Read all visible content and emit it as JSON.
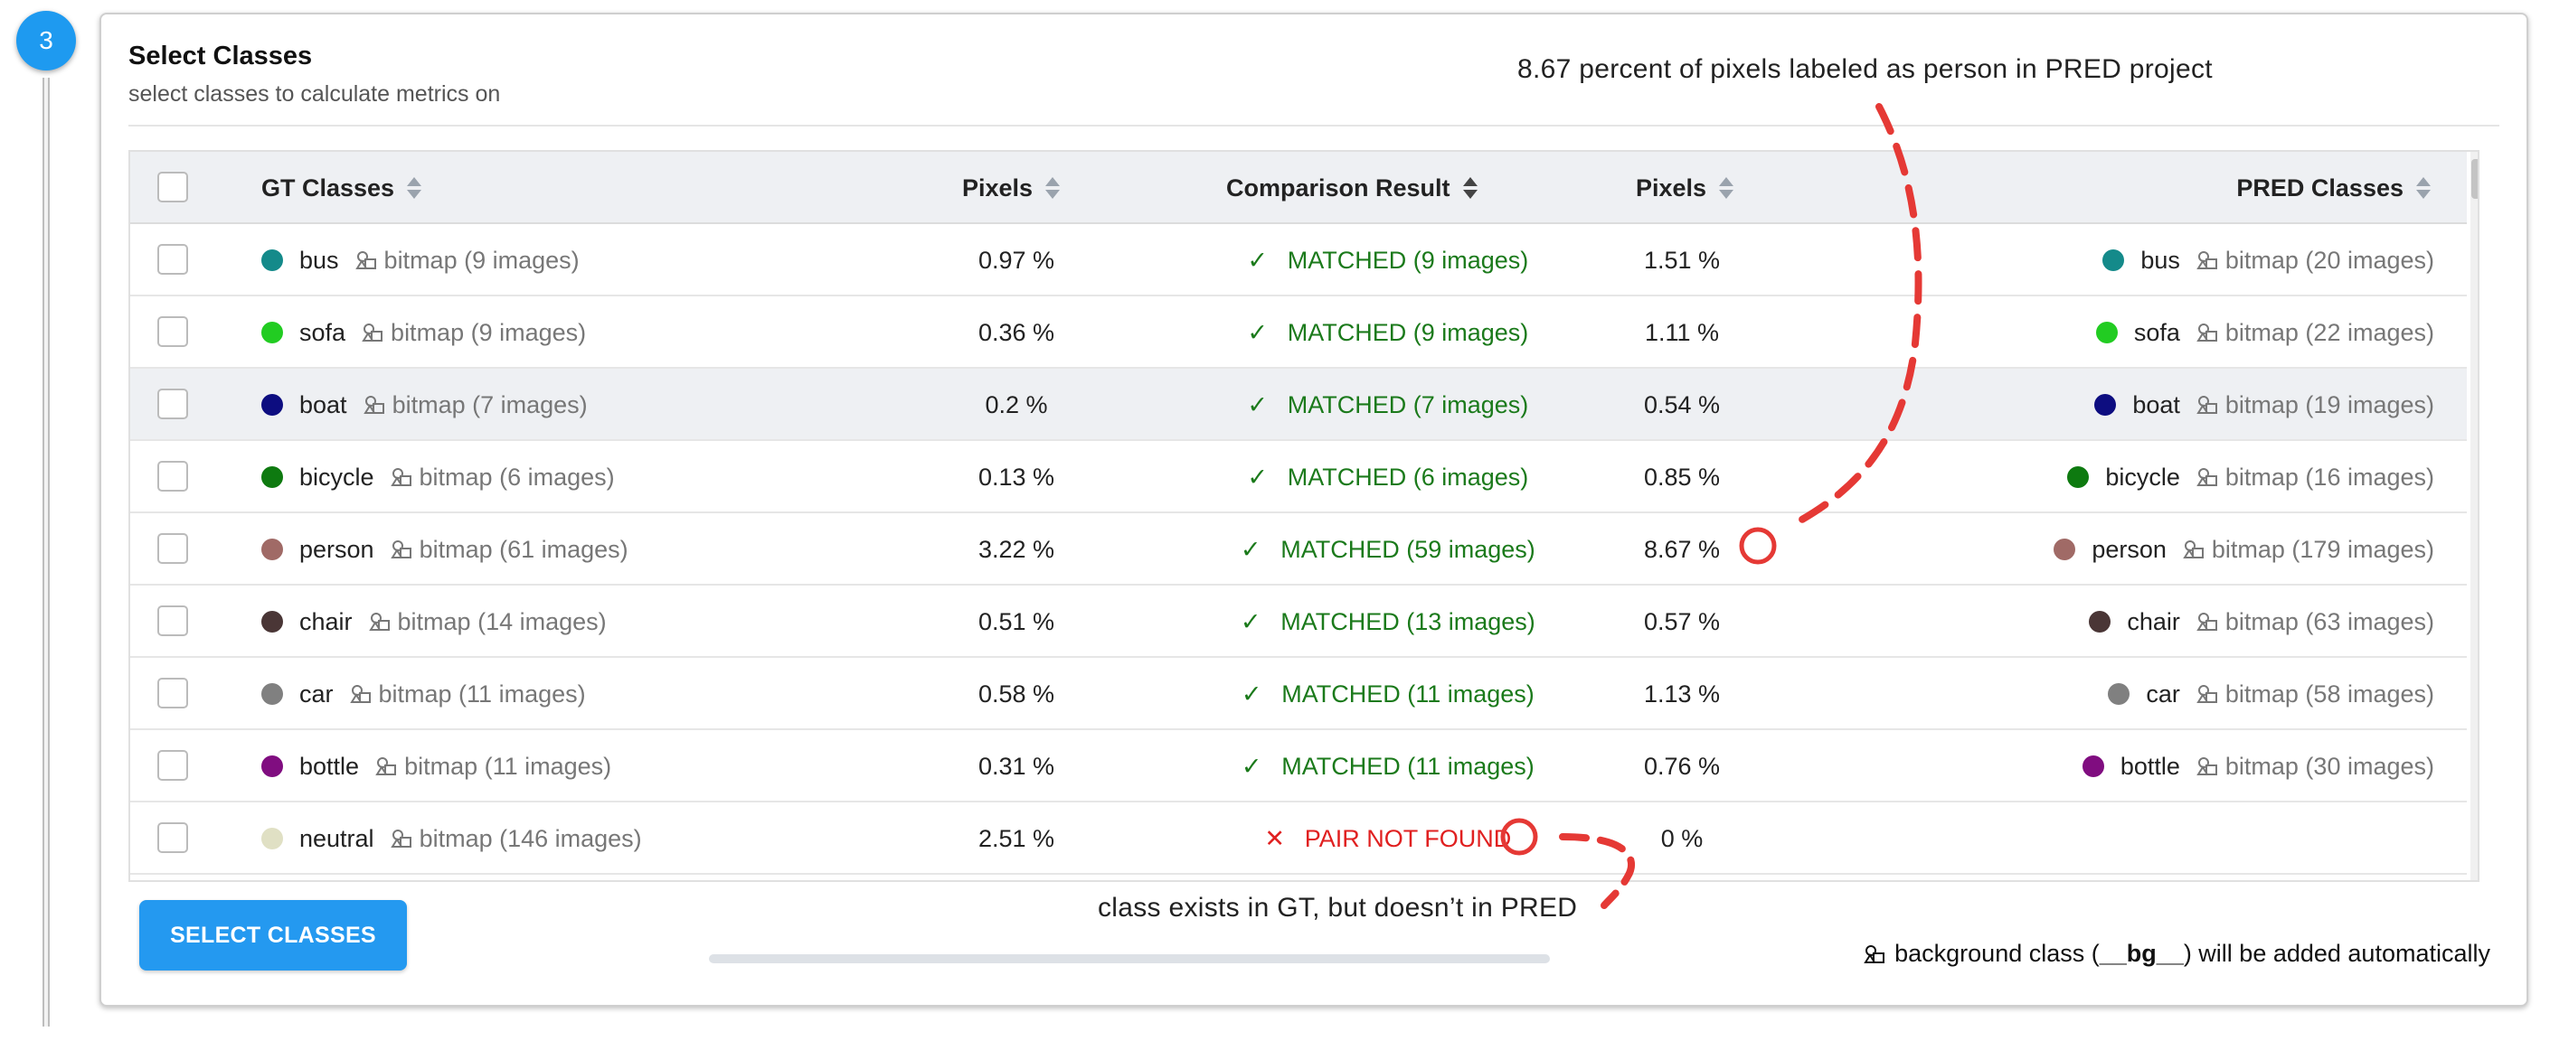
{
  "step": {
    "number": "3"
  },
  "card": {
    "title": "Select Classes",
    "subtitle": "select classes to calculate metrics on"
  },
  "table": {
    "headers": {
      "gt_classes": "GT Classes",
      "gt_pixels": "Pixels",
      "comparison": "Comparison Result",
      "pred_pixels": "Pixels",
      "pred_classes": "PRED Classes"
    },
    "rows": [
      {
        "gt_name": "bus",
        "gt_color": "#148a8a",
        "gt_bitmap": "bitmap (9 images)",
        "gt_pixels": "0.97 %",
        "status": "matched",
        "result": "MATCHED (9 images)",
        "pred_pixels": "1.51 %",
        "pred_name": "bus",
        "pred_color": "#148a8a",
        "pred_bitmap": "bitmap (20 images)"
      },
      {
        "gt_name": "sofa",
        "gt_color": "#22cc22",
        "gt_bitmap": "bitmap (9 images)",
        "gt_pixels": "0.36 %",
        "status": "matched",
        "result": "MATCHED (9 images)",
        "pred_pixels": "1.11 %",
        "pred_name": "sofa",
        "pred_color": "#22cc22",
        "pred_bitmap": "bitmap (22 images)"
      },
      {
        "gt_name": "boat",
        "gt_color": "#0d0d80",
        "gt_bitmap": "bitmap (7 images)",
        "gt_pixels": "0.2 %",
        "status": "matched",
        "result": "MATCHED (7 images)",
        "pred_pixels": "0.54 %",
        "pred_name": "boat",
        "pred_color": "#0d0d80",
        "pred_bitmap": "bitmap (19 images)"
      },
      {
        "gt_name": "bicycle",
        "gt_color": "#0e7a10",
        "gt_bitmap": "bitmap (6 images)",
        "gt_pixels": "0.13 %",
        "status": "matched",
        "result": "MATCHED (6 images)",
        "pred_pixels": "0.85 %",
        "pred_name": "bicycle",
        "pred_color": "#0e7a10",
        "pred_bitmap": "bitmap (16 images)"
      },
      {
        "gt_name": "person",
        "gt_color": "#a06a66",
        "gt_bitmap": "bitmap (61 images)",
        "gt_pixels": "3.22 %",
        "status": "matched",
        "result": "MATCHED (59 images)",
        "pred_pixels": "8.67 %",
        "pred_name": "person",
        "pred_color": "#a06a66",
        "pred_bitmap": "bitmap (179 images)"
      },
      {
        "gt_name": "chair",
        "gt_color": "#4a3636",
        "gt_bitmap": "bitmap (14 images)",
        "gt_pixels": "0.51 %",
        "status": "matched",
        "result": "MATCHED (13 images)",
        "pred_pixels": "0.57 %",
        "pred_name": "chair",
        "pred_color": "#4a3636",
        "pred_bitmap": "bitmap (63 images)"
      },
      {
        "gt_name": "car",
        "gt_color": "#808080",
        "gt_bitmap": "bitmap (11 images)",
        "gt_pixels": "0.58 %",
        "status": "matched",
        "result": "MATCHED (11 images)",
        "pred_pixels": "1.13 %",
        "pred_name": "car",
        "pred_color": "#808080",
        "pred_bitmap": "bitmap (58 images)"
      },
      {
        "gt_name": "bottle",
        "gt_color": "#800d80",
        "gt_bitmap": "bitmap (11 images)",
        "gt_pixels": "0.31 %",
        "status": "matched",
        "result": "MATCHED (11 images)",
        "pred_pixels": "0.76 %",
        "pred_name": "bottle",
        "pred_color": "#800d80",
        "pred_bitmap": "bitmap (30 images)"
      },
      {
        "gt_name": "neutral",
        "gt_color": "#e0e0c4",
        "gt_bitmap": "bitmap (146 images)",
        "gt_pixels": "2.51 %",
        "status": "notfound",
        "result": "PAIR NOT FOUND",
        "pred_pixels": "0 %",
        "pred_name": "",
        "pred_color": "",
        "pred_bitmap": ""
      }
    ]
  },
  "footer": {
    "select_button": "SELECT CLASSES",
    "bg_note_prefix": "background class (",
    "bg_note_class": "__bg__",
    "bg_note_suffix": ") will be added automatically"
  },
  "annotations": {
    "top": "8.67 percent of pixels labeled as person in PRED project",
    "bottom": "class exists in GT, but doesn’t in PRED"
  },
  "colors": {
    "accent": "#2499f0",
    "matched": "#1b7a1b",
    "not_found": "#e02020",
    "annotation": "#e53935"
  },
  "icons": {
    "matched": "check-icon",
    "not_found": "cross-icon",
    "bitmap": "bitmap-shapes-icon",
    "sort": "sort-arrows-icon"
  }
}
